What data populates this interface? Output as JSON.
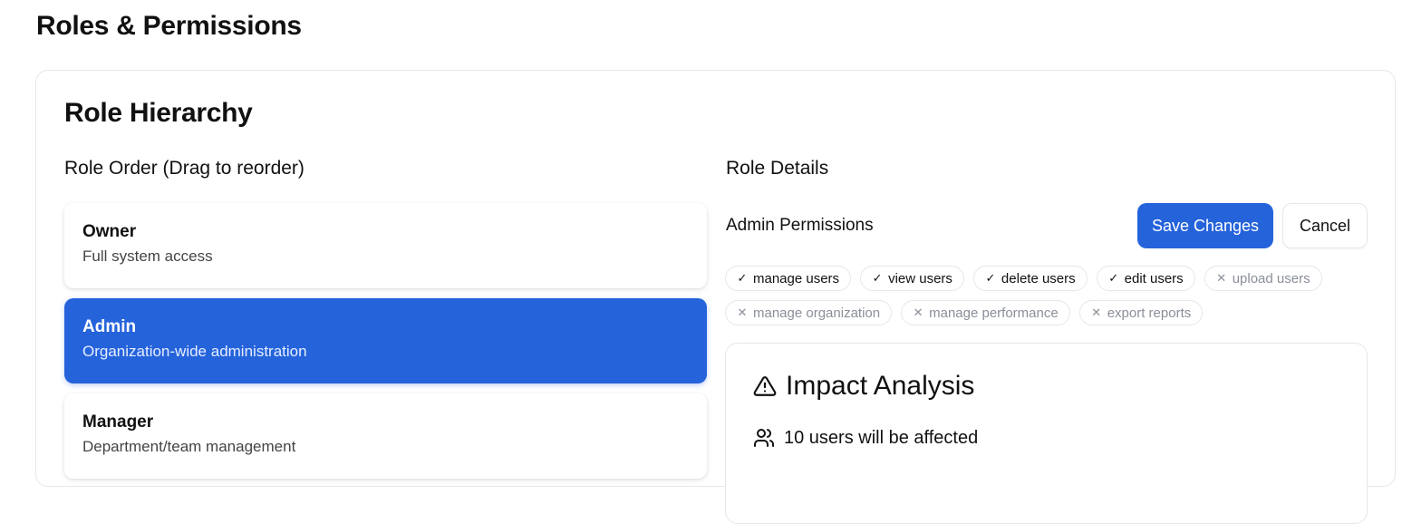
{
  "page": {
    "title": "Roles & Permissions"
  },
  "hierarchy": {
    "title": "Role Hierarchy",
    "order_heading": "Role Order (Drag to reorder)",
    "details_heading": "Role Details",
    "roles": [
      {
        "name": "Owner",
        "description": "Full system access",
        "selected": false
      },
      {
        "name": "Admin",
        "description": "Organization-wide administration",
        "selected": true
      },
      {
        "name": "Manager",
        "description": "Department/team management",
        "selected": false
      }
    ]
  },
  "details": {
    "permissions_title": "Admin Permissions",
    "save_label": "Save Changes",
    "cancel_label": "Cancel",
    "permissions": [
      {
        "label": "manage users",
        "granted": true
      },
      {
        "label": "view users",
        "granted": true
      },
      {
        "label": "delete users",
        "granted": true
      },
      {
        "label": "edit users",
        "granted": true
      },
      {
        "label": "upload users",
        "granted": false
      },
      {
        "label": "manage organization",
        "granted": false
      },
      {
        "label": "manage performance",
        "granted": false
      },
      {
        "label": "export reports",
        "granted": false
      }
    ]
  },
  "impact": {
    "title": "Impact Analysis",
    "icon": "alert-triangle-icon",
    "affected_text": "10 users will be affected",
    "affected_icon": "users-icon"
  },
  "colors": {
    "accent": "#2563db",
    "border": "#e5e7eb",
    "muted": "#8a8f98"
  }
}
